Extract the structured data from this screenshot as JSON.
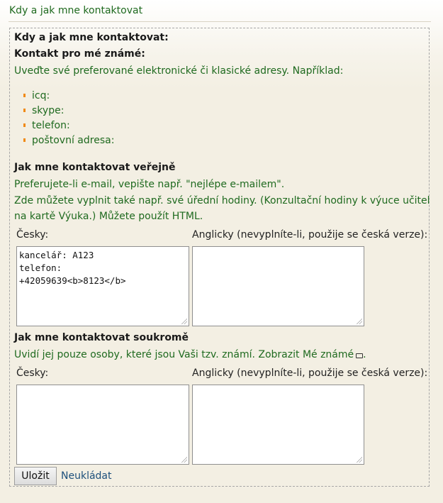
{
  "header": {
    "title": "Kdy a jak mne kontaktovat"
  },
  "section": {
    "title": "Kdy a jak mne kontaktovat:",
    "friends_heading": "Kontakt pro mé známé:",
    "friends_instructions": "Uveďte své preferované elektronické či klasické adresy. Například:",
    "example_items": [
      "icq:",
      "skype:",
      "telefon:",
      "poštovní adresa:"
    ]
  },
  "public": {
    "heading": "Jak mne kontaktovat veřejně",
    "note1": "Preferujete-li e-mail, vepište např. \"nejlépe e-mailem\".",
    "note2_line1": "Zde můžete vyplnit také např. své úřední hodiny. (Konzultační hodiny k výuce učitel uvádí",
    "note2_line2": "na kartě Výuka.) Můžete použít HTML.",
    "label_cz": "Česky:",
    "label_en": "Anglicky (nevyplníte-li, použije se česká verze):",
    "value_cz": "kancelář: A123\ntelefon:\n+42059639<b>8123</b>",
    "value_en": ""
  },
  "private": {
    "heading": "Jak mne kontaktovat soukromě",
    "note_text": "Uvidí jej pouze osoby, které jsou Vaši tzv. známí. Zobrazit Mé známé",
    "label_cz": "Česky:",
    "label_en": "Anglicky (nevyplníte-li, použije se česká verze):",
    "value_cz": "",
    "value_en": ""
  },
  "actions": {
    "save_label": "Uložit",
    "cancel_label": "Neukládat"
  },
  "icons": {
    "open_window": "external-window-icon",
    "bullet": "bullet-icon",
    "resize": "resize-grip-icon"
  },
  "colors": {
    "green_text": "#1f6a1f",
    "bullet": "#f08a16",
    "link": "#1c4f7b"
  }
}
